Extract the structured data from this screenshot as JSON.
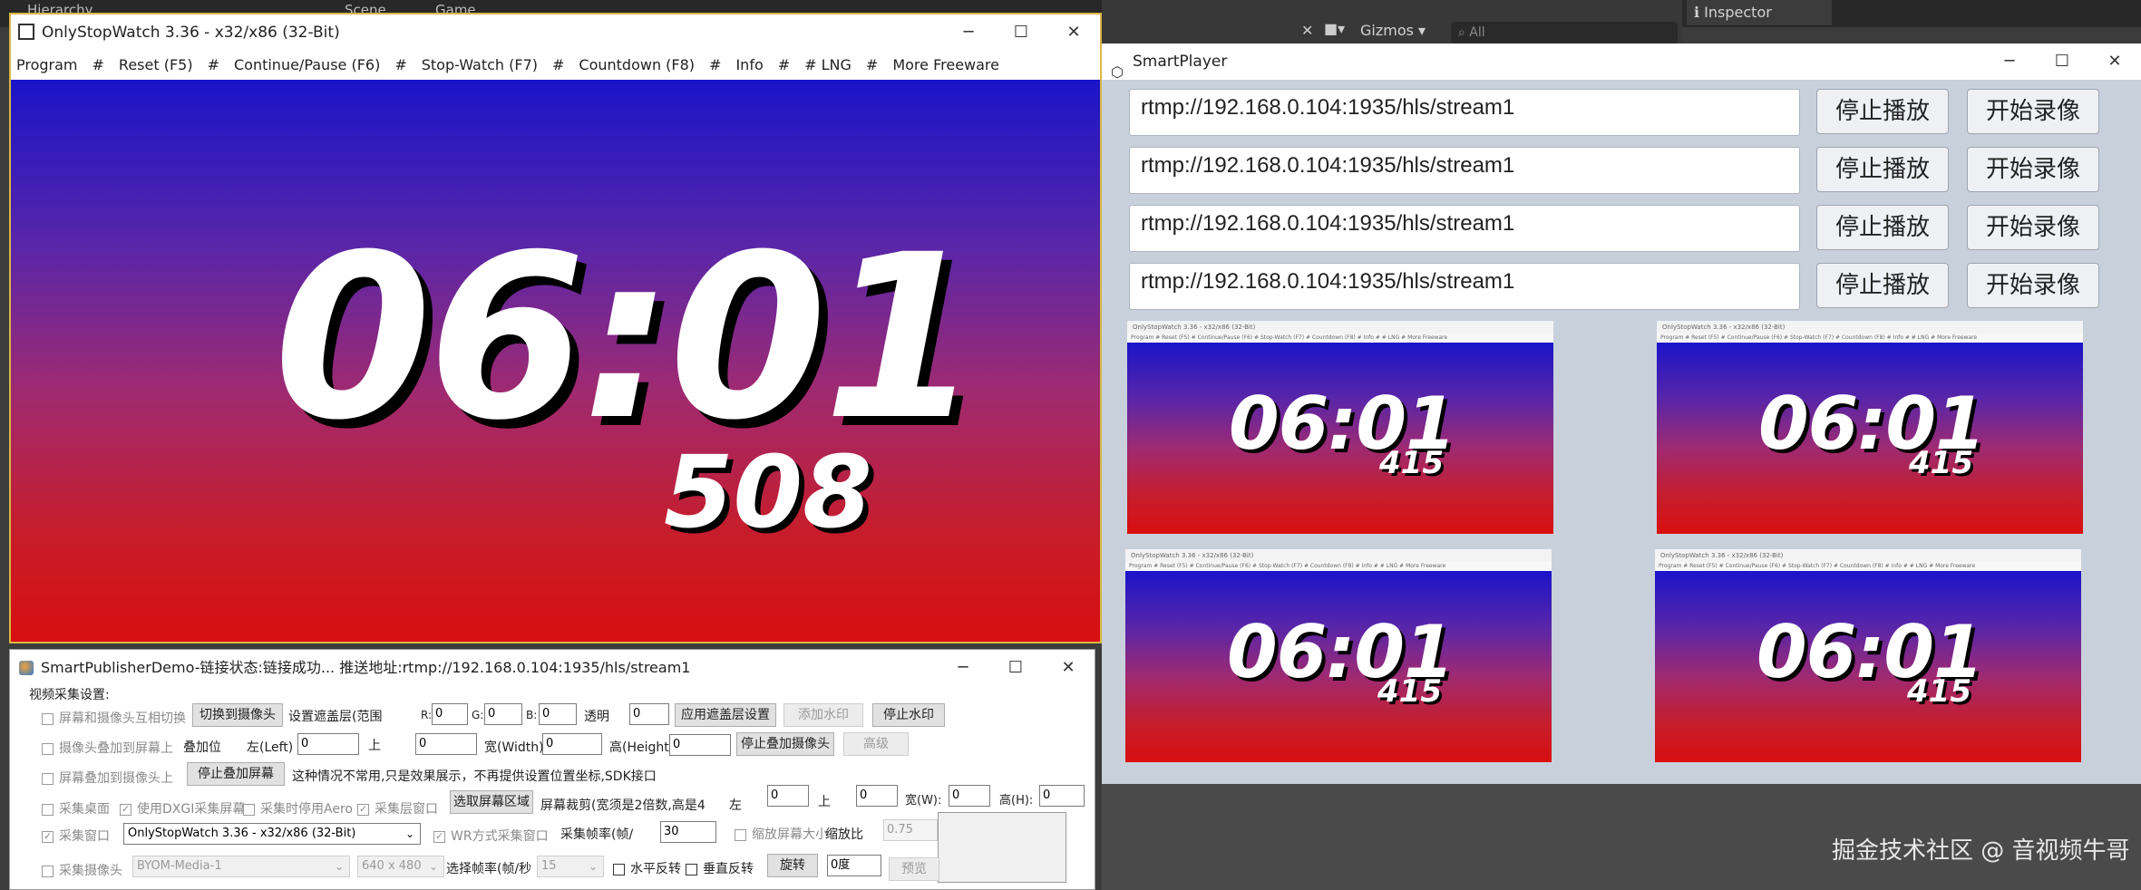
{
  "unity": {
    "tab_hierarchy": "Hierarchy",
    "tab_scene": "Scene",
    "tab_game": "Game",
    "inspector_tab": "Inspector",
    "gizmos_label": "Gizmos",
    "search_placeholder": "All"
  },
  "stopwatch": {
    "title": "OnlyStopWatch 3.36 - x32/x86 (32-Bit)",
    "menu": [
      "Program",
      "#",
      "Reset  (F5)",
      "#",
      "Continue/Pause (F6)",
      "#",
      "Stop-Watch  (F7)",
      "#",
      "Countdown  (F8)",
      "#",
      "Info",
      "#",
      "# LNG",
      "#",
      "More Freeware"
    ],
    "time": "06:01",
    "millis": "508"
  },
  "player": {
    "title": "SmartPlayer",
    "rows": [
      {
        "url": "rtmp://192.168.0.104:1935/hls/stream1",
        "stop_label": "停止播放",
        "record_label": "开始录像"
      },
      {
        "url": "rtmp://192.168.0.104:1935/hls/stream1",
        "stop_label": "停止播放",
        "record_label": "开始录像"
      },
      {
        "url": "rtmp://192.168.0.104:1935/hls/stream1",
        "stop_label": "停止播放",
        "record_label": "开始录像"
      },
      {
        "url": "rtmp://192.168.0.104:1935/hls/stream1",
        "stop_label": "停止播放",
        "record_label": "开始录像"
      }
    ],
    "thumb_title": "OnlyStopWatch 3.36 - x32/x86 (32-Bit)",
    "thumb_menu": "Program  #  Reset (F5)  #  Continue/Pause (F6)  #  Stop-Watch (F7)  #  Countdown (F8)  #  Info  #  # LNG  #  More Freeware",
    "thumbs": [
      {
        "time": "06:01",
        "millis": "415"
      },
      {
        "time": "06:01",
        "millis": "415"
      },
      {
        "time": "06:01",
        "millis": "415"
      },
      {
        "time": "06:01",
        "millis": "415"
      }
    ]
  },
  "publisher": {
    "title": "SmartPublisherDemo-链接状态:链接成功... 推送地址:rtmp://192.168.0.104:1935/hls/stream1",
    "section_label": "视频采集设置:",
    "row1": {
      "cb_label": "屏幕和摄像头互相切换",
      "switch_button": "切换到摄像头",
      "mask_range_label": "设置遮盖层(范围",
      "r_label": "R:",
      "r_value": "0",
      "g_label": "G:",
      "g_value": "0",
      "b_label": "B:",
      "b_value": "0",
      "alpha_label": "透明",
      "alpha_value": "0",
      "apply_mask_button": "应用遮盖层设置",
      "add_watermark_button": "添加水印",
      "stop_watermark_button": "停止水印"
    },
    "row2": {
      "cb_label": "摄像头叠加到屏幕上",
      "overlay_pos_label": "叠加位",
      "left_label": "左(Left)",
      "left_value": "0",
      "top_label": "上",
      "top_value": "0",
      "width_label": "宽(Width)",
      "width_value": "0",
      "height_label": "高(Height)",
      "height_value": "0",
      "stop_overlay_cam_button": "停止叠加摄像头",
      "advanced_button": "高级"
    },
    "row3": {
      "cb_label": "屏幕叠加到摄像头上",
      "stop_overlay_screen_button": "停止叠加屏幕",
      "note": "这种情况不常用,只是效果展示，不再提供设置位置坐标,SDK接口"
    },
    "row4": {
      "desktop_label": "采集桌面",
      "dxgi_label": "使用DXGI采集屏幕",
      "aero_label": "采集时停用Aero",
      "layer_label": "采集层窗口",
      "select_region_button": "选取屏幕区域",
      "crop_label": "屏幕裁剪(宽须是2倍数,高是4",
      "left_label": "左",
      "left_value": "0",
      "top_label": "上",
      "top_value": "0",
      "w_label": "宽(W):",
      "w_value": "0",
      "h_label": "高(H):",
      "h_value": "0"
    },
    "row5": {
      "window_label": "采集窗口",
      "window_select": "OnlyStopWatch 3.36 - x32/x86 (32-Bit)",
      "wr_label": "WR方式采集窗口",
      "fps_label": "采集帧率(帧/",
      "fps_value": "30",
      "scale_label": "缩放屏幕大小",
      "scale_ratio_label": "缩放比",
      "scale_value": "0.75"
    },
    "row6": {
      "camera_label": "采集摄像头",
      "camera_select": "BYOM-Media-1",
      "resolution_select": "640 x 480",
      "fps_select_label": "选择帧率(帧/秒",
      "fps_select": "15",
      "hflip_label": "水平反转",
      "vflip_label": "垂直反转",
      "rotate_button": "旋转",
      "rotate_value": "0度",
      "preview_button": "预览"
    }
  },
  "watermark": "掘金技术社区 @ 音视频牛哥",
  "colors": {
    "gradient_top": "#1a14c8",
    "gradient_bottom": "#d80f10",
    "stopwatch_border": "#d9b744",
    "player_bg": "#c8d0dc"
  }
}
